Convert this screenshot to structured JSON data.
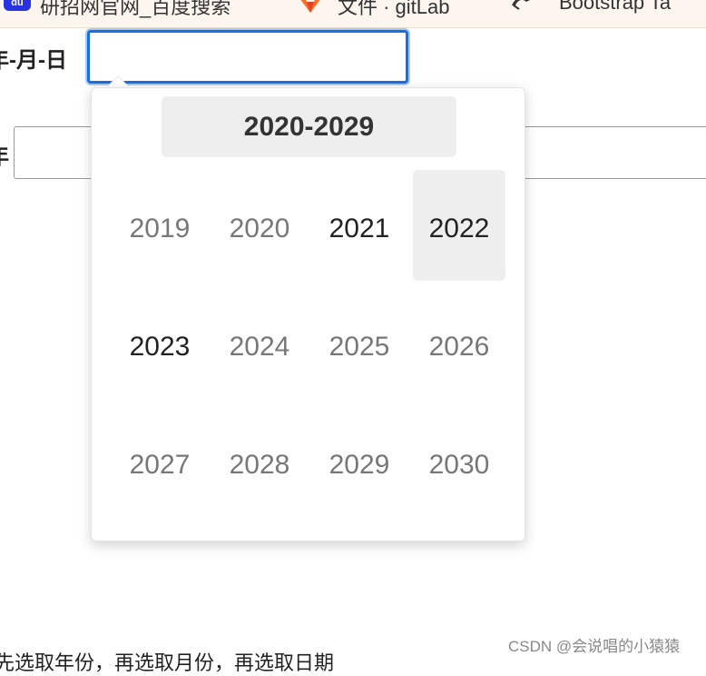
{
  "bookmarks": {
    "items": [
      {
        "label": "研招网官网_百度搜索",
        "icon": "baidu-icon",
        "icon_text": "du"
      },
      {
        "label": "文件 · gitLab",
        "icon": "gitlab-icon"
      },
      {
        "label": "Bootstrap Ta",
        "icon": "bootstrap-icon"
      }
    ]
  },
  "form": {
    "date_label": "年-月-日",
    "date_value": "",
    "second_label": "年"
  },
  "datepicker": {
    "decade_label": "2020-2029",
    "years": [
      {
        "label": "2019",
        "state": "outside"
      },
      {
        "label": "2020",
        "state": "normal"
      },
      {
        "label": "2021",
        "state": "selectable"
      },
      {
        "label": "2022",
        "state": "hovered"
      },
      {
        "label": "2023",
        "state": "selectable"
      },
      {
        "label": "2024",
        "state": "normal"
      },
      {
        "label": "2025",
        "state": "normal"
      },
      {
        "label": "2026",
        "state": "normal"
      },
      {
        "label": "2027",
        "state": "normal"
      },
      {
        "label": "2028",
        "state": "normal"
      },
      {
        "label": "2029",
        "state": "normal"
      },
      {
        "label": "2030",
        "state": "outside"
      }
    ]
  },
  "footer": {
    "text": "先选取年份，再选取月份，再选取日期",
    "watermark": "CSDN @会说唱的小猿猿"
  },
  "colors": {
    "accent": "#1a6fe0",
    "hover_bg": "#eeeeee",
    "muted_year": "#777777",
    "dark_year": "#222222"
  }
}
